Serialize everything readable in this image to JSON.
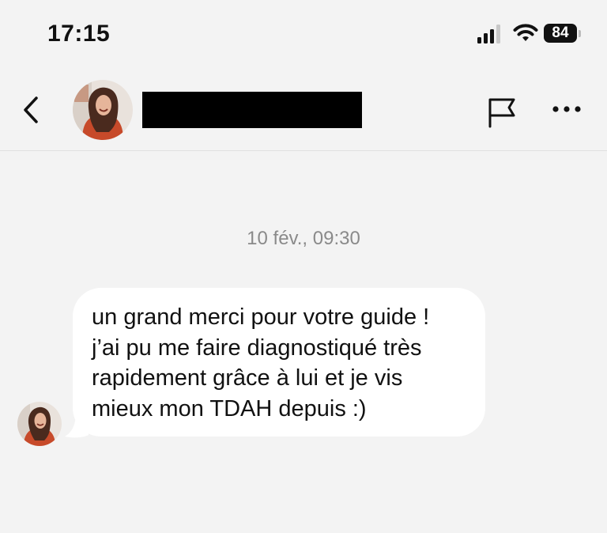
{
  "status_bar": {
    "time": "17:15",
    "battery_level": "84",
    "icons": [
      "signal-icon",
      "wifi-icon",
      "battery-icon"
    ]
  },
  "header": {
    "icons": [
      "chevron-left-icon",
      "flag-icon",
      "more-horizontal-icon"
    ],
    "contact_name_redacted": true
  },
  "conversation": {
    "timestamp": "10 fév., 09:30",
    "messages": [
      {
        "direction": "incoming",
        "text": "un grand merci pour votre guide !\nj’ai pu me faire diagnostiqué très\nrapidement grâce à lui et je vis\nmieux mon TDAH depuis :)"
      }
    ]
  },
  "colors": {
    "background": "#f3f3f3",
    "bubble": "#ffffff",
    "timestamp": "#8a8a8a",
    "text": "#111111"
  }
}
